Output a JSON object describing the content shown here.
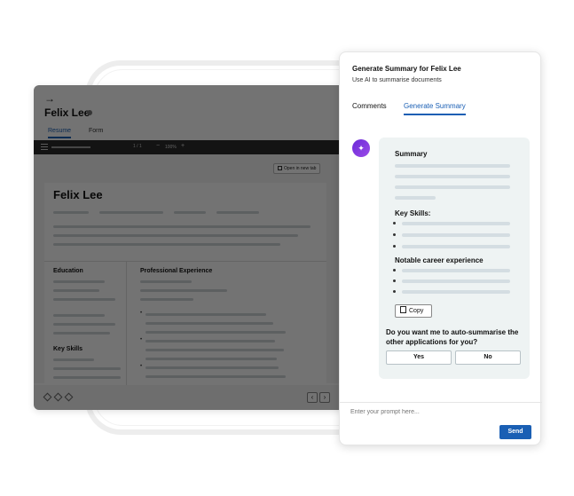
{
  "app": {
    "back_icon": "arrow-right-icon",
    "candidate_name": "Felix Lee",
    "tabs": [
      {
        "label": "Resume"
      },
      {
        "label": "Form"
      }
    ],
    "viewer": {
      "page": "1 / 1",
      "zoom_out": "−",
      "zoom_value": "100%",
      "zoom_in": "+"
    },
    "open_new_tab": "Open in new tab",
    "resume": {
      "name": "Felix Lee",
      "education": "Education",
      "experience": "Professional Experience",
      "skills": "Key Skills"
    },
    "pager": {
      "prev": "‹",
      "next": "›"
    }
  },
  "panel": {
    "title": "Generate Summary for Felix Lee",
    "subtitle": "Use AI to summarise documents",
    "tabs": [
      {
        "label": "Comments"
      },
      {
        "label": "Generate Summary"
      }
    ],
    "ai_icon": "sparkle-icon",
    "summary": {
      "summary_heading": "Summary",
      "skills_heading": "Key Skills:",
      "career_heading": "Notable career experience",
      "copy_label": "Copy",
      "question": "Do you want me to auto-summarise the other applications for you?",
      "yes": "Yes",
      "no": "No"
    },
    "prompt_placeholder": "Enter your prompt here...",
    "send": "Send"
  },
  "colors": {
    "accent": "#1a5fb4",
    "ai_gradient": "#6b2ad8"
  }
}
